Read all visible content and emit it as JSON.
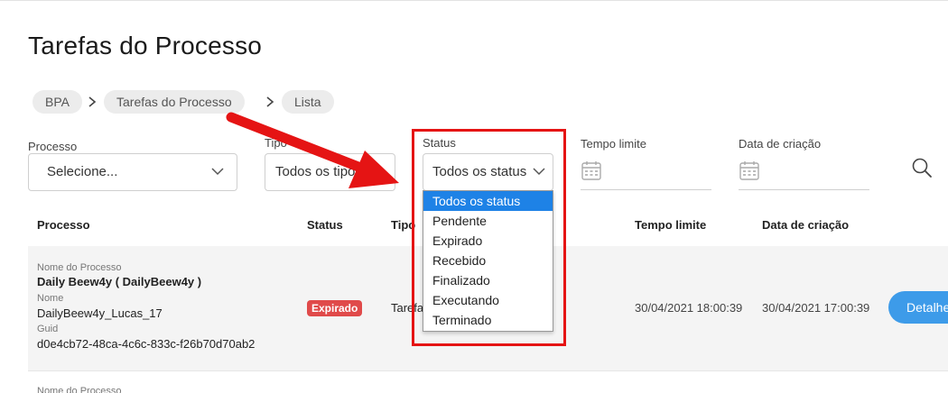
{
  "page": {
    "title": "Tarefas do Processo"
  },
  "breadcrumb": [
    "BPA",
    "Tarefas do Processo",
    "Lista"
  ],
  "filters": {
    "processo": {
      "label": "Processo",
      "value": "Selecione..."
    },
    "tipo": {
      "label": "Tipo",
      "value": "Todos os tipos"
    },
    "status": {
      "label": "Status",
      "value": "Todos os status"
    },
    "tempo_limite": {
      "label": "Tempo limite"
    },
    "data_criacao": {
      "label": "Data de criação"
    }
  },
  "status_dropdown": {
    "options": [
      "Todos os status",
      "Pendente",
      "Expirado",
      "Recebido",
      "Finalizado",
      "Executando",
      "Terminado"
    ],
    "selected_index": 0
  },
  "table": {
    "headers": {
      "processo": "Processo",
      "status": "Status",
      "tipo": "Tipo",
      "tempo_limite": "Tempo limite",
      "data_criacao": "Data de criação"
    },
    "rows": [
      {
        "nome_processo_label": "Nome do Processo",
        "nome_processo": "Daily Beew4y ( DailyBeew4y )",
        "nome_label": "Nome",
        "nome": "DailyBeew4y_Lucas_17",
        "guid_label": "Guid",
        "guid": "d0e4cb72-48ca-4c6c-833c-f26b70d70ab2",
        "status": "Expirado",
        "tipo": "Tarefa",
        "tempo_limite": "30/04/2021 18:00:39",
        "data_criacao": "30/04/2021 17:00:39",
        "action": "Detalhes"
      },
      {
        "nome_processo_label": "Nome do Processo"
      }
    ]
  },
  "colors": {
    "accent": "#3d9be9",
    "expired_badge": "#e04a4a",
    "highlight": "#e51414",
    "dropdown_selected": "#1e82e6"
  }
}
